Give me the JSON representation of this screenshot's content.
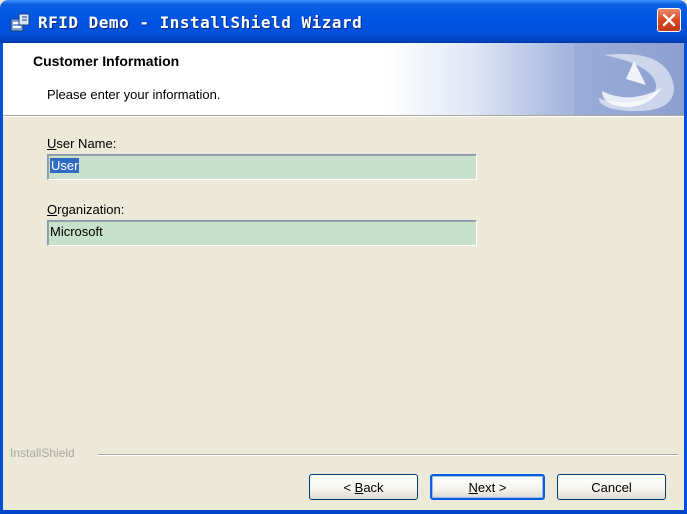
{
  "window": {
    "title": "RFID Demo - InstallShield Wizard",
    "title_icon": "installer-icon",
    "close_icon": "close-icon"
  },
  "header": {
    "title": "Customer Information",
    "subtitle": "Please enter your information.",
    "logo_icon": "installshield-logo-icon"
  },
  "form": {
    "user_name": {
      "label_access_key": "U",
      "label_rest": "ser Name:",
      "value": "User",
      "selected": true
    },
    "organization": {
      "label_access_key": "O",
      "label_rest": "rganization:",
      "value": "Microsoft"
    }
  },
  "footer": {
    "brand": "InstallShield",
    "back": {
      "prefix": "< ",
      "access_key": "B",
      "rest": "ack"
    },
    "next": {
      "access_key": "N",
      "rest": "ext >"
    },
    "cancel": "Cancel"
  },
  "colors": {
    "title_bar": "#0054e3",
    "dialog_bg": "#ece9d8",
    "field_bg": "#c8e1cc",
    "selection": "#316ac5",
    "close_button": "#d84a22"
  }
}
